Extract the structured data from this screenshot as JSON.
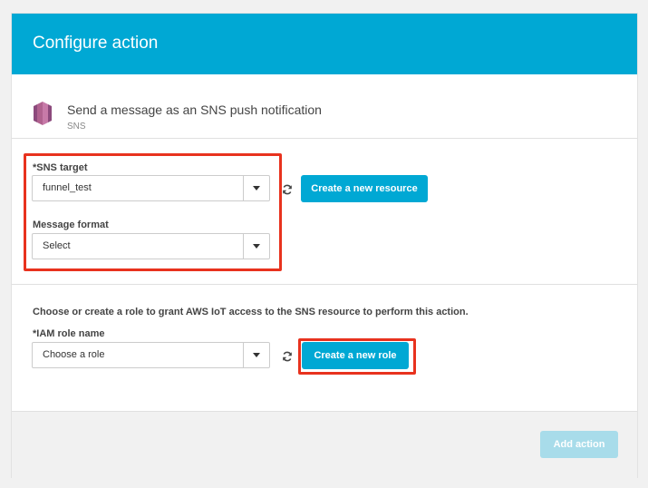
{
  "header": {
    "title": "Configure action"
  },
  "service": {
    "title": "Send a message as an SNS push notification",
    "subtitle": "SNS",
    "icon": "sns-icon"
  },
  "sns_target": {
    "label": "*SNS target",
    "value": "funnel_test"
  },
  "message_format": {
    "label": "Message format",
    "value": "Select"
  },
  "create_resource_button": "Create a new resource",
  "role_section": {
    "description": "Choose or create a role to grant AWS IoT access to the SNS resource to perform this action.",
    "label": "*IAM role name",
    "value": "Choose a role",
    "create_button": "Create a new role"
  },
  "footer": {
    "add_action_button": "Add action"
  },
  "colors": {
    "accent": "#00a8d4",
    "highlight": "#e8321e",
    "disabled": "#a8dcea"
  }
}
